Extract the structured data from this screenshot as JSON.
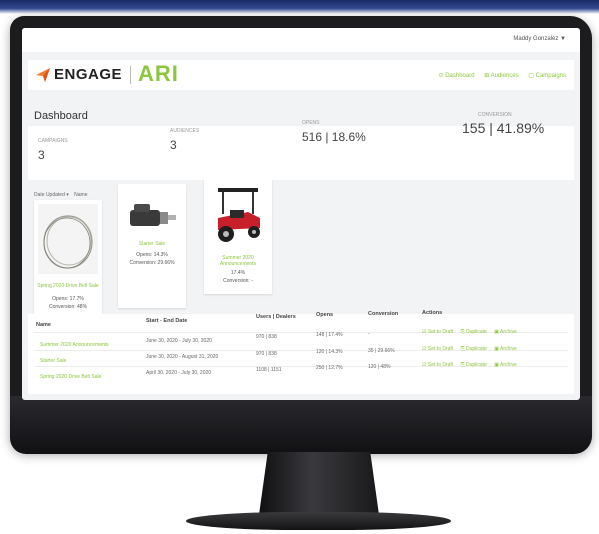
{
  "header": {
    "user_menu": "Maddy Gonzalez ▼",
    "brand_engage": "ENGAGE",
    "brand_ari": "ARI",
    "nav": [
      "Dashboard",
      "Audiences",
      "Campaigns"
    ]
  },
  "dashboard": {
    "title": "Dashboard",
    "stats": [
      {
        "label": "Campaigns",
        "value": "3"
      },
      {
        "label": "Audiences",
        "value": "3"
      },
      {
        "label": "Opens",
        "value": "516 | 18.6%"
      },
      {
        "label": "Conversion",
        "value": "155 | 41.89%"
      }
    ]
  },
  "sort_bar": {
    "label": "Date Updated",
    "option": "Name"
  },
  "cards": [
    {
      "name": "Spring 2020 Drive Belt Sale",
      "line1": "Opens: 17.7%",
      "line2": "Conversion: 48%"
    },
    {
      "name": "Starter Sale",
      "line1": "Opens: 14.3%",
      "line2": "Conversion: 29.66%"
    },
    {
      "name": "Summer 2020 Announcements",
      "line1": "17.4%",
      "line2": "Conversion: -"
    }
  ],
  "table": {
    "headers": [
      "Name",
      "Start - End Date",
      "Users | Dealers",
      "Opens",
      "Conversion",
      "Actions"
    ],
    "rows": [
      {
        "name": "Summer 2020 Announcements",
        "dates": "June 30, 2020 - July 30, 2020",
        "users": "970 | 838",
        "opens": "148 | 17.4%",
        "conversion": "-"
      },
      {
        "name": "Starter Sale",
        "dates": "June 30, 2020 - August 31, 2020",
        "users": "970 | 838",
        "opens": "120 | 14.3%",
        "conversion": "35 | 29.66%"
      },
      {
        "name": "Spring 2020 Drive Belt Sale",
        "dates": "April 30, 2020 - July 30, 2020",
        "users": "1108 | 1151",
        "opens": "250 | 12.7%",
        "conversion": "120 | 48%"
      }
    ],
    "actions": [
      "Set to Draft",
      "Duplicate",
      "Archive"
    ]
  }
}
